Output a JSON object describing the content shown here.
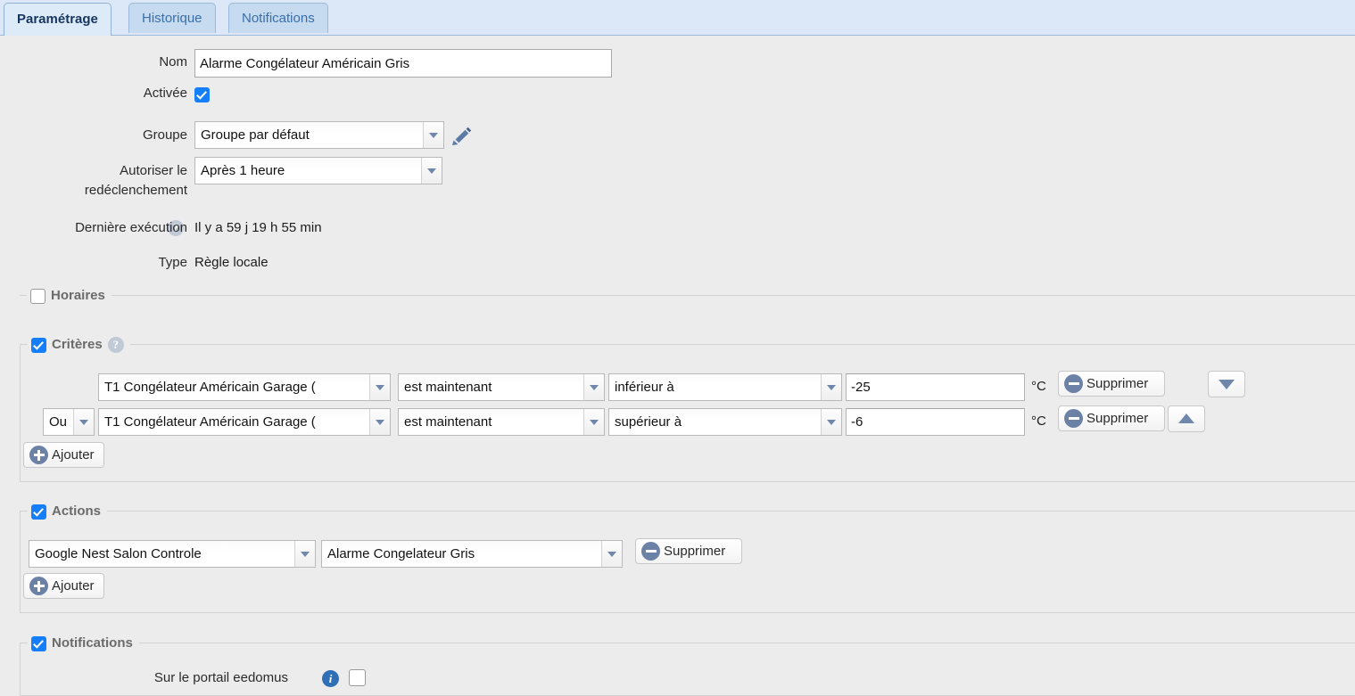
{
  "tabs": [
    {
      "label": "Paramétrage",
      "active": true
    },
    {
      "label": "Historique",
      "active": false
    },
    {
      "label": "Notifications",
      "active": false
    }
  ],
  "form": {
    "name_label": "Nom",
    "name_value": "Alarme Congélateur Américain Gris",
    "enabled_label": "Activée",
    "group_label": "Groupe",
    "group_value": "Groupe par défaut",
    "retrigger_label_line1": "Autoriser le",
    "retrigger_label_line2": "redéclenchement",
    "retrigger_value": "Après 1 heure",
    "last_run_label": "Dernière exécution",
    "last_run_value": "Il y a 59 j 19 h 55 min",
    "type_label": "Type",
    "type_value": "Règle locale",
    "help_glyph": "?",
    "edit_icon_name": "pencil-icon"
  },
  "sections": {
    "schedules": {
      "legend": "Horaires",
      "checked": false
    },
    "criteria": {
      "legend": "Critères",
      "checked": true,
      "help_glyph": "?"
    },
    "actions": {
      "legend": "Actions",
      "checked": true
    },
    "notifications": {
      "legend": "Notifications",
      "checked": true
    }
  },
  "criteria": {
    "rows": [
      {
        "operator": "",
        "source": "T1 Congélateur Américain Garage (",
        "condition": "est maintenant",
        "comparator": "inférieur à",
        "value": "-25",
        "unit": "°C",
        "delete_label": "Supprimer",
        "move_arrow": "down"
      },
      {
        "operator": "Ou",
        "source": "T1 Congélateur Américain Garage (",
        "condition": "est maintenant",
        "comparator": "supérieur à",
        "value": "-6",
        "unit": "°C",
        "delete_label": "Supprimer",
        "move_arrow": "up"
      }
    ],
    "add_label": "Ajouter"
  },
  "actions": {
    "rows": [
      {
        "device": "Google Nest Salon Controle",
        "command": "Alarme Congelateur Gris",
        "delete_label": "Supprimer"
      }
    ],
    "add_label": "Ajouter"
  },
  "notifications": {
    "portal_label": "Sur le portail eedomus",
    "portal_checked": false
  },
  "colors": {
    "page_bg": "#ececec",
    "tabbar_bg": "#dce8f7",
    "tab_active_bg": "#ddebf9",
    "tab_inactive_bg": "#c6dbf0",
    "accent_checkbox": "#157efb",
    "icon_slate": "#6b82a6",
    "legend_text": "#6b6b6b"
  }
}
